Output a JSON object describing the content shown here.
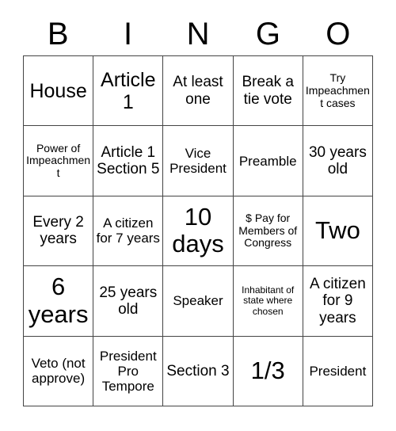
{
  "card": {
    "header_letters": [
      "B",
      "I",
      "N",
      "G",
      "O"
    ],
    "grid": {
      "rows": 5,
      "columns": 5,
      "border_color": "#444444",
      "background_color": "#ffffff",
      "text_color": "#000000"
    },
    "cells": [
      {
        "text": "House",
        "size": "fs-lg"
      },
      {
        "text": "Article 1",
        "size": "fs-lg"
      },
      {
        "text": "At least one",
        "size": "fs-md"
      },
      {
        "text": "Break a tie vote",
        "size": "fs-md"
      },
      {
        "text": "Try Impeachment cases",
        "size": "fs-xs"
      },
      {
        "text": "Power of Impeachment",
        "size": "fs-xs"
      },
      {
        "text": "Article 1 Section 5",
        "size": "fs-md"
      },
      {
        "text": "Vice President",
        "size": "fs-sm"
      },
      {
        "text": "Preamble",
        "size": "fs-sm"
      },
      {
        "text": "30 years old",
        "size": "fs-md"
      },
      {
        "text": "Every 2 years",
        "size": "fs-md"
      },
      {
        "text": "A citizen for 7 years",
        "size": "fs-sm"
      },
      {
        "text": "10 days",
        "size": "fs-xl"
      },
      {
        "text": "$ Pay for Members of Congress",
        "size": "fs-xs"
      },
      {
        "text": "Two",
        "size": "fs-xl"
      },
      {
        "text": "6 years",
        "size": "fs-xl"
      },
      {
        "text": "25 years old",
        "size": "fs-md"
      },
      {
        "text": "Speaker",
        "size": "fs-sm"
      },
      {
        "text": "Inhabitant of state where chosen",
        "size": "fs-xxs"
      },
      {
        "text": "A citizen for 9 years",
        "size": "fs-md"
      },
      {
        "text": "Veto (not approve)",
        "size": "fs-sm"
      },
      {
        "text": "President Pro Tempore",
        "size": "fs-sm"
      },
      {
        "text": "Section 3",
        "size": "fs-md"
      },
      {
        "text": "1/3",
        "size": "fs-xl"
      },
      {
        "text": "President",
        "size": "fs-sm"
      }
    ]
  }
}
